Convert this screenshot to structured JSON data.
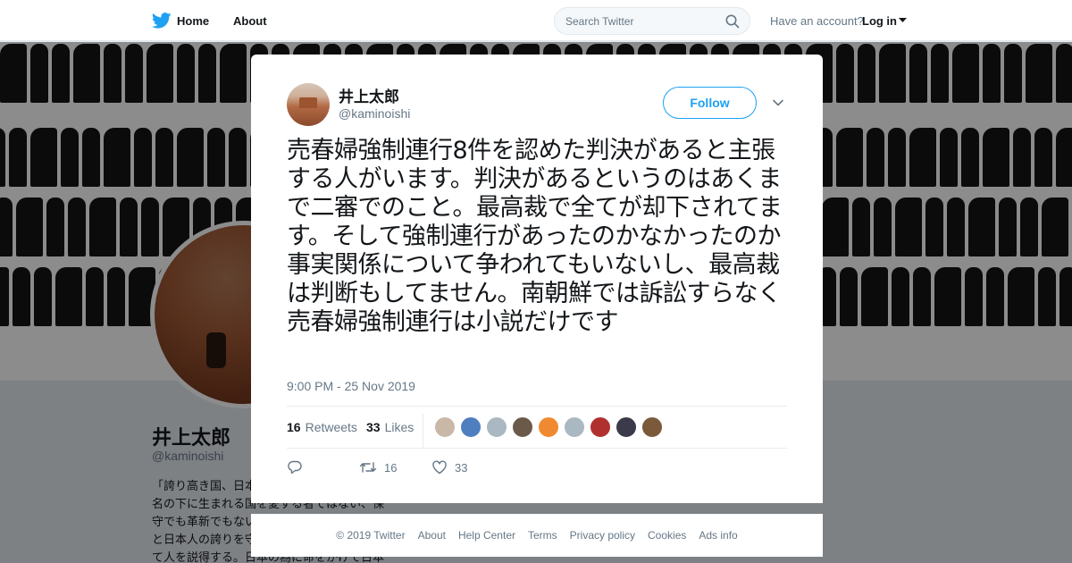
{
  "nav": {
    "home_label": "Home",
    "about_label": "About",
    "search_placeholder": "Search Twitter",
    "have_account": "Have an account?",
    "login_label": "Log in"
  },
  "colors": {
    "brand": "#1da1f2",
    "text": "#14171a",
    "secondary": "#657786",
    "overlay": "rgba(0,0,0,0.45)"
  },
  "profile": {
    "name": "井上太郎",
    "handle": "@kaminoishi",
    "bio": "「誇り高き国、日本」がスローガン。保守の名の下に生まれる国を愛する者ではない、保守でも革新でもない。ただ日本を愛し、日本と日本人の誇りを守りたいだけ。根拠を示して人を説得する。日本の為に命をかけて日本を守った魂が周車に知り"
  },
  "tweet": {
    "author_name": "井上太郎",
    "author_handle": "@kaminoishi",
    "follow_label": "Follow",
    "text": "売春婦強制連行8件を認めた判決があると主張する人がいます。判決があるというのはあくまで二審でのこと。最高裁で全てが却下されてます。そして強制連行があったのかなかったのか事実関係について争われてもいないし、最高裁は判断もしてません。南朝鮮では訴訟すらなく売春婦強制連行は小説だけです",
    "timestamp": "9:00 PM - 25 Nov 2019",
    "retweets_count": "16",
    "retweets_label": "Retweets",
    "likes_count": "33",
    "likes_label": "Likes",
    "action_retweet_count": "16",
    "action_like_count": "33",
    "liker_avatars": [
      "#c9b8a8",
      "#4f7fbf",
      "#aab8c2",
      "#6b5a4a",
      "#f08a30",
      "#aab8c2",
      "#b03030",
      "#3a3a4a",
      "#7a5a3a"
    ]
  },
  "footer": {
    "copyright": "© 2019 Twitter",
    "about": "About",
    "help": "Help Center",
    "terms": "Terms",
    "privacy": "Privacy policy",
    "cookies": "Cookies",
    "ads": "Ads info"
  }
}
